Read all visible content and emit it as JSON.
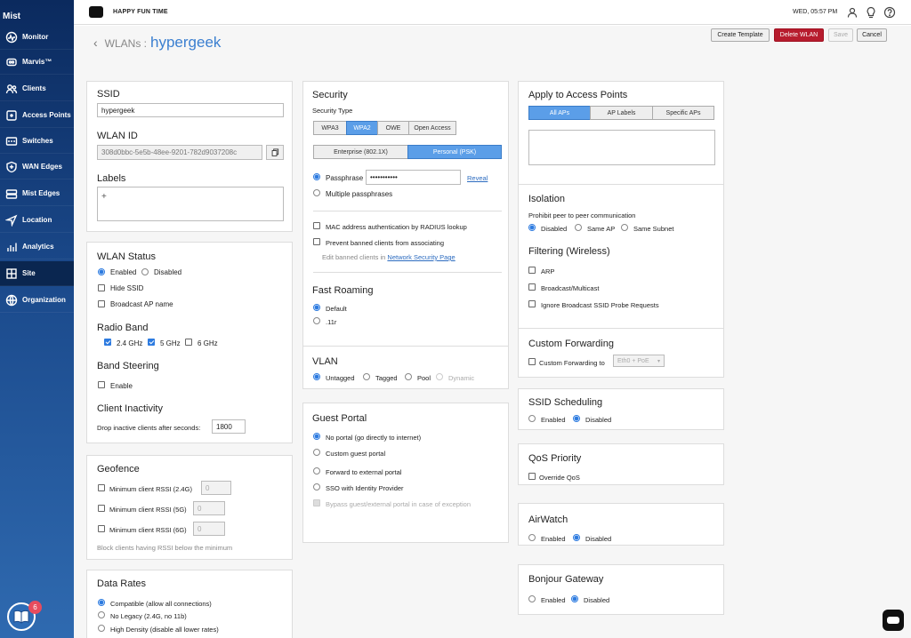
{
  "sidebar": {
    "logo": "Mist",
    "items": [
      {
        "label": "Monitor",
        "icon": "monitor-icon"
      },
      {
        "label": "Marvis™",
        "icon": "marvis-icon"
      },
      {
        "label": "Clients",
        "icon": "clients-icon"
      },
      {
        "label": "Access Points",
        "icon": "access-points-icon"
      },
      {
        "label": "Switches",
        "icon": "switches-icon"
      },
      {
        "label": "WAN Edges",
        "icon": "wan-edges-icon"
      },
      {
        "label": "Mist Edges",
        "icon": "mist-edges-icon"
      },
      {
        "label": "Location",
        "icon": "location-icon"
      },
      {
        "label": "Analytics",
        "icon": "analytics-icon"
      },
      {
        "label": "Site",
        "icon": "site-icon"
      },
      {
        "label": "Organization",
        "icon": "organization-icon"
      }
    ],
    "active_index": 9,
    "help_badge": "6"
  },
  "topbar": {
    "org_name": "HAPPY FUN TIME",
    "clock": "WED, 05:57 PM"
  },
  "header": {
    "breadcrumb_prefix": "WLANs :",
    "title": "hypergeek",
    "buttons": {
      "create_template": "Create Template",
      "delete_wlan": "Delete WLAN",
      "save": "Save",
      "cancel": "Cancel"
    }
  },
  "ssid": {
    "title": "SSID",
    "value": "hypergeek",
    "wlan_id_title": "WLAN ID",
    "wlan_id": "308d0bbc-5e5b-48ee-9201-782d9037208c",
    "labels_title": "Labels",
    "labels_add": "+"
  },
  "wlan_status": {
    "title": "WLAN Status",
    "enabled": "Enabled",
    "disabled": "Disabled",
    "hide_ssid": "Hide SSID",
    "broadcast_ap_name": "Broadcast AP name",
    "radio_band_title": "Radio Band",
    "band_24": "2.4 GHz",
    "band_5": "5 GHz",
    "band_6": "6 GHz",
    "band_steering_title": "Band Steering",
    "band_steering_enable": "Enable",
    "client_inactivity_title": "Client Inactivity",
    "drop_inactive_label": "Drop inactive clients after seconds:",
    "drop_inactive_value": "1800"
  },
  "geofence": {
    "title": "Geofence",
    "rssi_24": "Minimum client RSSI (2.4G)",
    "rssi_5": "Minimum client RSSI (5G)",
    "rssi_6": "Minimum client RSSI (6G)",
    "rssi_value": "0",
    "note": "Block clients having RSSI below the minimum"
  },
  "data_rates": {
    "title": "Data Rates",
    "compatible": "Compatible (allow all connections)",
    "no_legacy": "No Legacy (2.4G, no 11b)",
    "high_density": "High Density (disable all lower rates)"
  },
  "security": {
    "title": "Security",
    "type_label": "Security Type",
    "types": [
      "WPA3",
      "WPA2",
      "OWE",
      "Open Access"
    ],
    "modes": [
      "Enterprise (802.1X)",
      "Personal (PSK)"
    ],
    "passphrase_label": "Passphrase",
    "passphrase_value": "•••••••••••",
    "reveal": "Reveal",
    "multiple_passphrases": "Multiple passphrases",
    "mac_auth": "MAC address authentication by RADIUS lookup",
    "prevent_banned": "Prevent banned clients from associating",
    "edit_banned_prefix": "Edit banned clients in",
    "edit_banned_link": "Network Security Page"
  },
  "fast_roaming": {
    "title": "Fast Roaming",
    "default": "Default",
    "r11": ".11r"
  },
  "vlan": {
    "title": "VLAN",
    "untagged": "Untagged",
    "tagged": "Tagged",
    "pool": "Pool",
    "dynamic": "Dynamic"
  },
  "guest_portal": {
    "title": "Guest Portal",
    "no_portal": "No portal (go directly to internet)",
    "custom": "Custom guest portal",
    "forward_external": "Forward to external portal",
    "sso": "SSO with Identity Provider",
    "bypass": "Bypass guest/external portal in case of exception"
  },
  "apply_aps": {
    "title": "Apply to Access Points",
    "tabs": [
      "All APs",
      "AP Labels",
      "Specific APs"
    ]
  },
  "isolation": {
    "title": "Isolation",
    "subtitle": "Prohibit peer to peer communication",
    "disabled": "Disabled",
    "same_ap": "Same AP",
    "same_subnet": "Same Subnet",
    "filtering_title": "Filtering (Wireless)",
    "arp": "ARP",
    "broadcast_multicast": "Broadcast/Multicast",
    "ignore_probe": "Ignore Broadcast SSID Probe Requests"
  },
  "custom_forwarding": {
    "title": "Custom Forwarding",
    "label": "Custom Forwarding to",
    "select_value": "Eth0 + PoE"
  },
  "ssid_scheduling": {
    "title": "SSID Scheduling",
    "enabled": "Enabled",
    "disabled": "Disabled"
  },
  "qos": {
    "title": "QoS Priority",
    "override": "Override QoS"
  },
  "airwatch": {
    "title": "AirWatch",
    "enabled": "Enabled",
    "disabled": "Disabled"
  },
  "bonjour": {
    "title": "Bonjour Gateway",
    "enabled": "Enabled",
    "disabled": "Disabled"
  },
  "colors": {
    "accent": "#3b7fd0",
    "danger": "#b71c2e",
    "sidebar": "#0b2a5e"
  }
}
